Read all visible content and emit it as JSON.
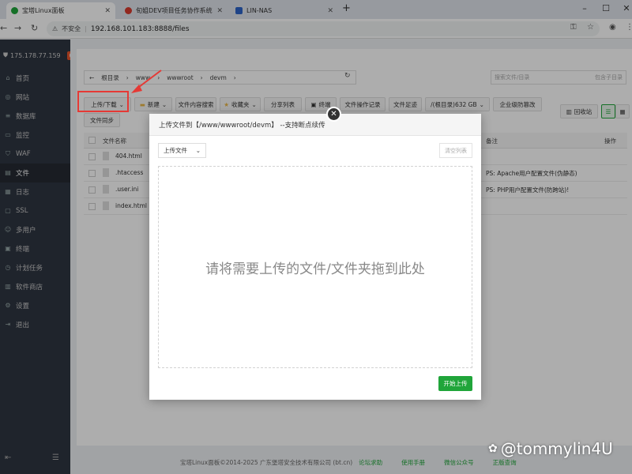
{
  "browser": {
    "tabs": [
      {
        "title": "宝塔Linux面板",
        "active": true,
        "favicon_color": "#20a53a"
      },
      {
        "title": "旬姐DEV项目任务协作系统:",
        "active": false,
        "favicon_color": "#d83b2f"
      },
      {
        "title": "LIN-NAS",
        "active": false,
        "favicon_color": "#2d64c8"
      }
    ],
    "security_label": "不安全",
    "url": "192.168.101.183:8888/files"
  },
  "sidebar": {
    "server_ip": "175.178.77.159",
    "badge": "0",
    "items": [
      {
        "label": "首页",
        "icon": "home-icon"
      },
      {
        "label": "网站",
        "icon": "globe-icon"
      },
      {
        "label": "数据库",
        "icon": "database-icon"
      },
      {
        "label": "监控",
        "icon": "monitor-icon"
      },
      {
        "label": "WAF",
        "icon": "shield-icon"
      },
      {
        "label": "文件",
        "icon": "folder-icon",
        "active": true
      },
      {
        "label": "日志",
        "icon": "log-icon"
      },
      {
        "label": "SSL",
        "icon": "ssl-icon"
      },
      {
        "label": "多用户",
        "icon": "users-icon"
      },
      {
        "label": "终端",
        "icon": "terminal-icon"
      },
      {
        "label": "计划任务",
        "icon": "clock-icon"
      },
      {
        "label": "软件商店",
        "icon": "store-icon"
      },
      {
        "label": "设置",
        "icon": "gear-icon"
      },
      {
        "label": "退出",
        "icon": "logout-icon"
      }
    ]
  },
  "files": {
    "tab_label": "devm",
    "breadcrumb": [
      "根目录",
      "www",
      "wwwroot",
      "devm"
    ],
    "search_placeholder": "搜索文件/目录",
    "subdir_label": "包含子目录",
    "toolbar": {
      "upload": "上传/下载",
      "new": "新建",
      "content_search": "文件内容搜索",
      "favorites": "收藏夹",
      "share_list": "分享列表",
      "terminal": "终端",
      "op_log": "文件操作记录",
      "file_footprint": "文件足迹",
      "disk": "/(根目录)632 GB",
      "enterprise": "企业级防篡改",
      "sync": "文件同步",
      "recycle": "回收站"
    },
    "columns": {
      "name": "文件名称",
      "remark": "备注",
      "action": "操作"
    },
    "rows": [
      {
        "name": "404.html",
        "remark": ""
      },
      {
        "name": ".htaccess",
        "remark": "PS: Apache用户配置文件(伪静态)"
      },
      {
        "name": ".user.ini",
        "remark": "PS: PHP用户配置文件(防跨站)!"
      },
      {
        "name": "index.html",
        "remark": ""
      }
    ]
  },
  "modal": {
    "title": "上传文件到【/www/wwwroot/devm】 --支持断点续传",
    "upload_select": "上传文件",
    "clear_list": "清空列表",
    "dropzone_text": "请将需要上传的文件/文件夹拖到此处",
    "start_button": "开始上传"
  },
  "footer": {
    "copyright": "宝塔Linux面板©2014-2025 广东堡塔安全技术有限公司 (bt.cn)",
    "links": [
      "论坛求助",
      "使用手册",
      "微信公众号",
      "正版查询"
    ]
  },
  "watermark": "@tommylin4U"
}
